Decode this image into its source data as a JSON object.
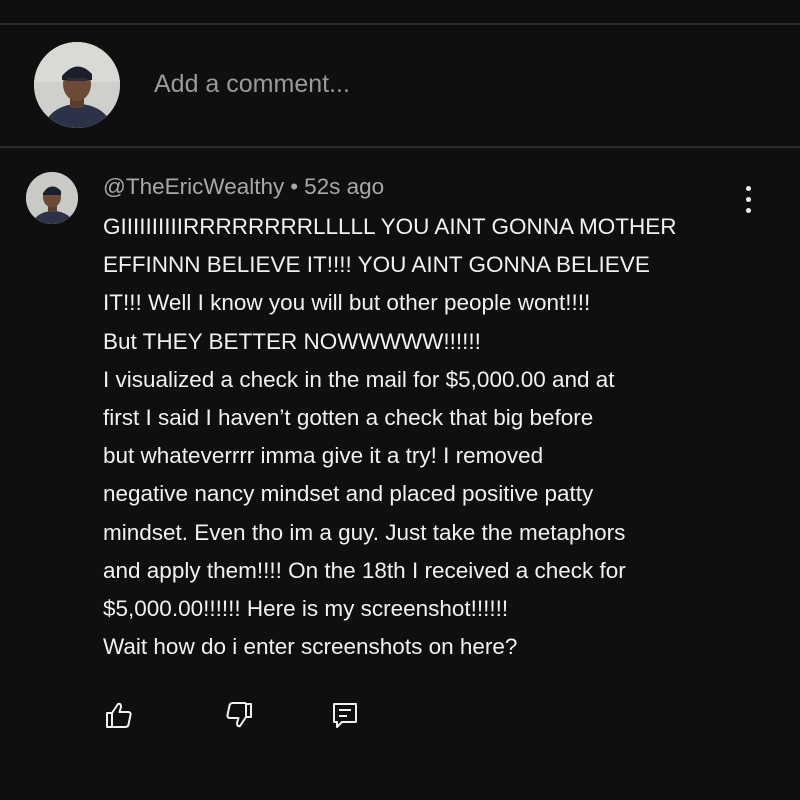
{
  "composer": {
    "placeholder": "Add a comment..."
  },
  "comment": {
    "author": "@TheEricWealthy",
    "separator": "•",
    "time": "52s ago",
    "lines": [
      "GIIIIIIIIIIRRRRRRRRLLLLL YOU AINT GONNA MOTHER",
      "EFFINNN BELIEVE IT!!!! YOU AINT GONNA BELIEVE",
      "IT!!! Well I know you will but other people wont!!!!",
      "But THEY BETTER NOWWWWW!!!!!!",
      "I visualized a check in the mail for $5,000.00 and at",
      "first I said I haven’t gotten a check that big before",
      "but whateverrrr imma give it a try! I removed",
      "negative nancy mindset and placed positive patty",
      "mindset. Even tho im a guy. Just take the metaphors",
      "and apply them!!!! On the 18th I received a check for",
      "$5,000.00!!!!!! Here is my screenshot!!!!!!",
      "Wait how do i enter screenshots on here?"
    ]
  },
  "actions": {
    "like_icon": "thumbs-up-icon",
    "dislike_icon": "thumbs-down-icon",
    "reply_icon": "reply-comment-icon"
  },
  "colors": {
    "background": "#0f0f0f",
    "text_primary": "#f1f1f1",
    "text_secondary": "#a8a8a8",
    "placeholder": "#9a9a9a",
    "divider": "#2a2a2a"
  }
}
